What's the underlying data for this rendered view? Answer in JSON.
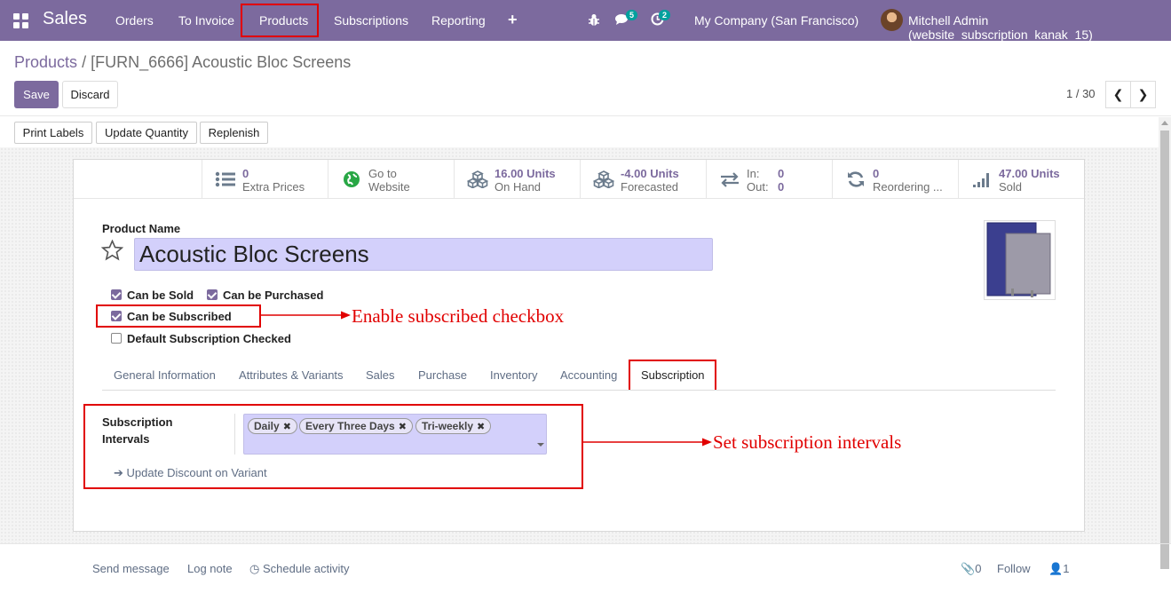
{
  "navbar": {
    "app_name": "Sales",
    "menu": [
      "Orders",
      "To Invoice",
      "Products",
      "Subscriptions",
      "Reporting"
    ],
    "plus": "+",
    "messages_count": "5",
    "activities_count": "2",
    "company": "My Company (San Francisco)",
    "user": "Mitchell Admin (website_subscription_kanak_15)"
  },
  "breadcrumb": {
    "parent": "Products",
    "separator": "/",
    "current": "[FURN_6666] Acoustic Bloc Screens"
  },
  "buttons": {
    "save": "Save",
    "discard": "Discard"
  },
  "pager": {
    "value": "1 / 30"
  },
  "actions": [
    "Print Labels",
    "Update Quantity",
    "Replenish"
  ],
  "smart_buttons": [
    {
      "icon": "list-icon",
      "value": "0",
      "label": "Extra Prices"
    },
    {
      "icon": "globe-icon",
      "value": "Go to",
      "label": "Website"
    },
    {
      "icon": "cubes-icon",
      "value": "16.00 Units",
      "label": "On Hand"
    },
    {
      "icon": "cubes-icon",
      "value": "-4.00 Units",
      "label": "Forecasted"
    },
    {
      "icon": "exchange-icon",
      "in_label": "In:",
      "in_value": "0",
      "out_label": "Out:",
      "out_value": "0"
    },
    {
      "icon": "refresh-icon",
      "value": "0",
      "label": "Reordering ..."
    },
    {
      "icon": "signal-icon",
      "value": "47.00 Units",
      "label": "Sold"
    }
  ],
  "form": {
    "product_name_label": "Product Name",
    "product_name": "Acoustic Bloc Screens",
    "can_be_sold": "Can be Sold",
    "can_be_purchased": "Can be Purchased",
    "can_be_subscribed": "Can be Subscribed",
    "default_subscription": "Default Subscription Checked",
    "checkbox_states": {
      "sold": true,
      "purchased": true,
      "subscribed": true,
      "default_subscription": false
    }
  },
  "annotations": {
    "subscribed": "Enable subscribed checkbox",
    "intervals": "Set subscription intervals"
  },
  "tabs": [
    "General Information",
    "Attributes & Variants",
    "Sales",
    "Purchase",
    "Inventory",
    "Accounting",
    "Subscription"
  ],
  "active_tab": "Subscription",
  "subscription": {
    "label_line1": "Subscription",
    "label_line2": "Intervals",
    "tags": [
      "Daily",
      "Every Three Days",
      "Tri-weekly"
    ],
    "update_link": "Update Discount on Variant"
  },
  "chatter": {
    "send_message": "Send message",
    "log_note": "Log note",
    "schedule_activity": "Schedule activity",
    "attachments": "0",
    "follow": "Follow",
    "followers": "1"
  },
  "colors": {
    "brand": "#7c6a9e",
    "annotation_red": "#e10000",
    "input_bg": "#d3d0fb",
    "badge": "#00a09d"
  }
}
